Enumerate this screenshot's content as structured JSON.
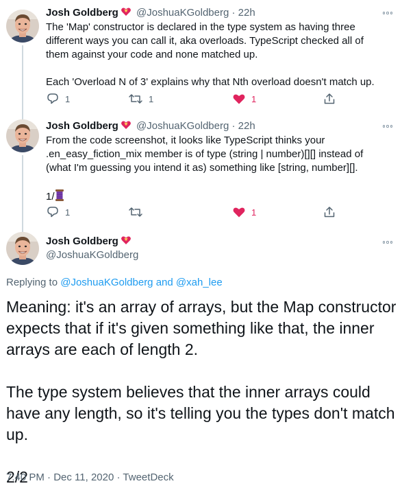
{
  "colors": {
    "text": "#0f1419",
    "secondary": "#536471",
    "link": "#1d9bf0",
    "like_red": "#e0245e",
    "thread_line": "#cfd9de"
  },
  "tweets": [
    {
      "name": "Josh Goldberg",
      "handle": "@JoshuaKGoldberg",
      "separator": "·",
      "time": "22h",
      "text": "The 'Map' constructor is declared in the type system as having three different ways you can call it, aka overloads. TypeScript checked all of them against your code and none matched up.\n\nEach 'Overload N of 3' explains why that Nth overload doesn't match up.",
      "reply_count": "1",
      "retweet_count": "1",
      "like_count": "1",
      "liked": true
    },
    {
      "name": "Josh Goldberg",
      "handle": "@JoshuaKGoldberg",
      "separator": "·",
      "time": "22h",
      "text": "From the code screenshot, it looks like TypeScript thinks your .en_easy_fiction_mix member is of type (string | number)[][] instead of (what I'm guessing you intend it as) something like [string, number][].",
      "tail_text": "1/",
      "tail_emoji": "thread-spool-emoji",
      "reply_count": "1",
      "retweet_count": "",
      "like_count": "1",
      "liked": true
    }
  ],
  "main": {
    "name": "Josh Goldberg",
    "handle": "@JoshuaKGoldberg",
    "replying_prefix": "Replying to ",
    "replying_user1": "@JoshuaKGoldberg",
    "replying_and": " and ",
    "replying_user2": "@xah_lee",
    "text": "Meaning: it's an array of arrays, but the Map constructor expects that if it's given something like that, the inner arrays are each of length 2.\n\nThe type system believes that the inner arrays could have any length, so it's telling you the types don't match up.\n\n2/2",
    "time": "7:40 PM",
    "separator": "·",
    "date": "Dec 11, 2020",
    "app": "TweetDeck"
  },
  "icons": {
    "name_badge": "heart-with-ribbon-icon",
    "more": "more-options-icon",
    "reply": "reply-icon",
    "retweet": "retweet-icon",
    "like": "like-heart-icon",
    "share": "share-icon"
  }
}
